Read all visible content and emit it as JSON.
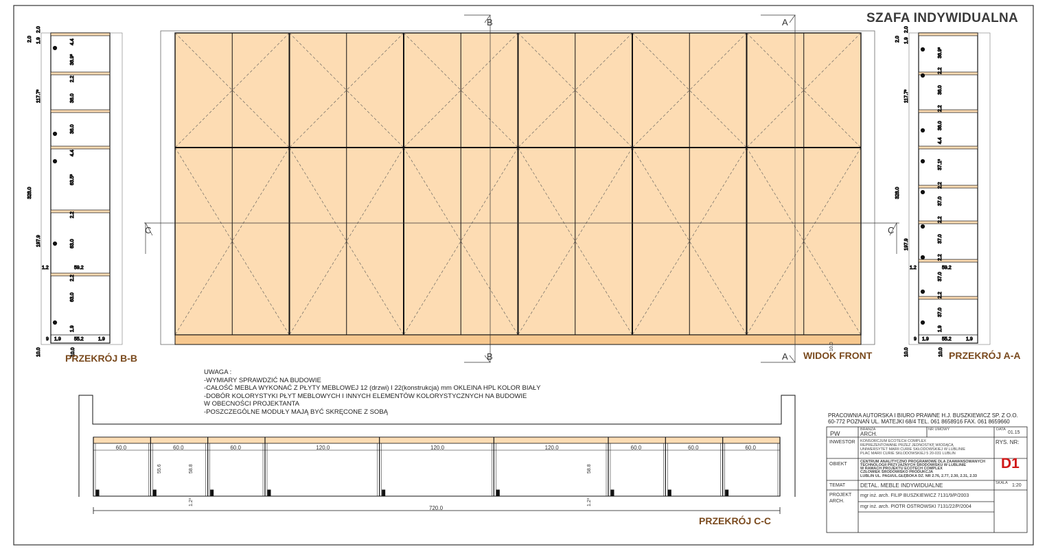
{
  "title": "SZAFA INDYWIDUALNA",
  "labels": {
    "front": "WIDOK FRONT",
    "section_bb": "PRZEKRÓJ  B-B",
    "section_aa": "PRZEKRÓJ A-A",
    "section_cc": "PRZEKRÓJ  C-C"
  },
  "section_markers": {
    "a": "A",
    "b": "B",
    "c": "C"
  },
  "notes": [
    "UWAGA :",
    "-WYMIARY SPRAWDZIĆ NA BUDOWIE",
    "-CAŁOŚĆ MEBLA WYKONAĆ Z PŁYTY MEBLOWEJ  12 (drzwi) I 22(konstrukcja) mm OKLEINA HPL  KOLOR BIAŁY",
    "-DOBÓR KOLORYSTYKI PŁYT MEBLOWYCH I INNYCH ELEMENTÓW   KOLORYSTYCZNYCH NA BUDOWIE",
    " W OBECNOŚCI PROJEKTANTA",
    "-POSZCZEGÓLNE MODUŁY MAJĄ BYĆ SKRĘCONE Z SOBĄ"
  ],
  "dims_bb": {
    "top_a": "2.0",
    "top_b": "2.0",
    "h1": "1.9",
    "total": "328.0",
    "upper": "117.7³",
    "lower": "197.9",
    "c1": "36.9³",
    "c2": "4.4",
    "c3": "2.2",
    "c4": "36.0",
    "c5": "36.0",
    "c6": "4.4",
    "c7": "63.5³",
    "c8": "2.2",
    "c9": "63.0",
    "c10": "2.2",
    "c11": "63.0",
    "c12": "1.9",
    "left_off": "1.2",
    "depth": "59.2",
    "base": "10.0",
    "b1": "9",
    "b2": "1.9",
    "b3": "55.2",
    "b4": "1.9"
  },
  "dims_aa": {
    "top_a": "2.0",
    "top_b": "2.0",
    "h1": "1.9",
    "total": "328.0",
    "upper": "117.7³",
    "lower": "197.9",
    "c1": "36.9³",
    "c2": "2.2",
    "c3": "36.0",
    "c4": "2.2",
    "c5": "36.0",
    "c6": "4.4",
    "c7": "37.1³",
    "c8": "2.2",
    "c9": "37.0",
    "c10": "2.2",
    "c11": "37.0",
    "c12": "2.2",
    "c13": "37.0",
    "c14": "2.2",
    "c15": "37.0",
    "c16": "1.9",
    "left_off": "1.2",
    "depth": "59.2",
    "base": "10.0",
    "b1": "9",
    "b2": "1.9",
    "b3": "55.2",
    "b4": "1.9"
  },
  "dims_cc": {
    "modules": [
      "60.0",
      "60.0",
      "60.0",
      "120.0",
      "120.0",
      "120.0",
      "60.0",
      "60.0",
      "60.0"
    ],
    "h1": "55.6",
    "h2": "58.8",
    "h3": "58.8",
    "gap1": "1.2³",
    "gap2": "1.2³",
    "total": "720.0"
  },
  "front_base": "10.0",
  "title_block": {
    "firm_line1": "PRACOWNIA AUTORSKA I BIURO PRAWNE H.J. BUSZKIEWICZ SP. Z O.O.",
    "firm_line2": "60-772 POZNAŃ UL. MATEJKI 68/4 TEL. 061 8658916 FAX. 061 8659660",
    "pw": "PW",
    "branza_hdr": "BRANŻA",
    "nr_umowy_hdr": "NR UMOWY",
    "data_hdr": "DATA",
    "branza": "ARCH.",
    "date": "01.15",
    "inwestor_label": "INWESTOR",
    "inwestor": [
      "KONSORCJUM ECOTECH COMPLEX",
      "REPREZENTOWANE PRZEZ JEDNOSTKĘ WIODĄCĄ",
      "UNIWERSYTET MARII CURIE SKŁODOWSKIEJ W LUBLINIE",
      "PLAC MARII CURIE SKŁODOWSKIEJ 5   20-031 LUBLIN"
    ],
    "rys_label": "RYS. NR:",
    "rys_nr": "D1",
    "obiekt_label": "OBIEKT",
    "obiekt": [
      "CENTRUM ANALITYCZNO PROGRAMOWE DLA ZAAWANSOWANYCH",
      "TECHNOLOGII PRZYJAZNYCH ŚRODOWISKU W LUBLINIE",
      "W RAMACH PROJEKTU ECOTECH COMPLEX",
      "CZŁOWIEK ŚRODOWISKO PRODUKCJA",
      "LUBLIN UL. PAGI/UL.GŁĘBOKA DZ. NR 2.76, 2.77, 2.30, 2.31, 2.33"
    ],
    "temat_label": "TEMAT",
    "temat": "DETAL. MEBLE INDYWIDUALNE",
    "skala_label": "SKALA",
    "skala": "1:20",
    "projekt_label1": "PROJEKT",
    "projekt_label2": "ARCH.",
    "author1": "mgr inż. arch. FILIP BUSZKIEWICZ 7131/9/P/2003",
    "author2": "mgr inż. arch. PIOTR OSTROWSKI 7131/22/P/2004"
  },
  "colors": {
    "fill": "#fddcb3",
    "fill_base": "#f7c88f",
    "line": "#111111",
    "label": "#7a4a1e",
    "accent": "#d01818"
  }
}
